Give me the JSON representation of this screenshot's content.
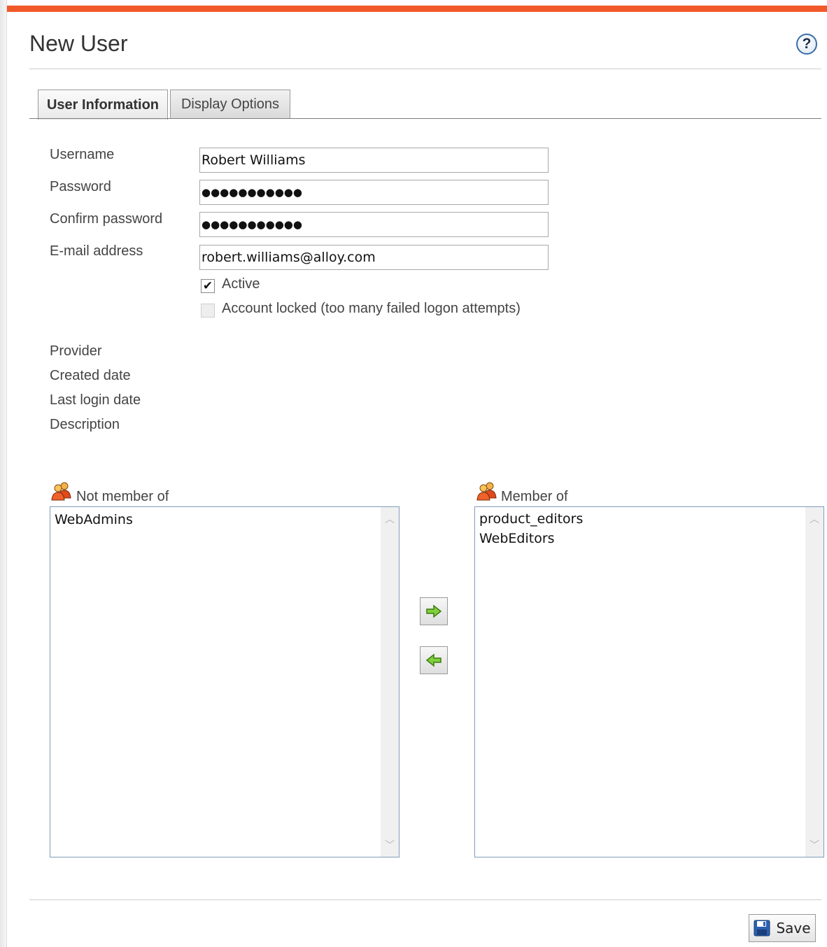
{
  "header": {
    "title": "New User",
    "help_glyph": "?",
    "accent_color": "#f1592a"
  },
  "tabs": [
    {
      "label": "User Information",
      "active": true
    },
    {
      "label": "Display Options",
      "active": false
    }
  ],
  "form": {
    "username": {
      "label": "Username",
      "value": "Robert Williams"
    },
    "password": {
      "label": "Password",
      "value": "●●●●●●●●●●●"
    },
    "confirm_password": {
      "label": "Confirm password",
      "value": "●●●●●●●●●●●"
    },
    "email": {
      "label": "E-mail address",
      "value": "robert.williams@alloy.com"
    },
    "active": {
      "label": "Active",
      "checked": true,
      "glyph": "✔"
    },
    "locked": {
      "label": "Account locked (too many failed logon attempts)",
      "checked": false,
      "disabled": true
    }
  },
  "info": {
    "provider_label": "Provider",
    "created_label": "Created date",
    "last_login_label": "Last login date",
    "description_label": "Description"
  },
  "groups": {
    "not_member_label": "Not member of",
    "not_member_items": [
      "WebAdmins"
    ],
    "member_label": "Member of",
    "member_items": [
      "product_editors",
      "WebEditors"
    ],
    "icon": "user-group-icon"
  },
  "footer": {
    "save_label": "Save",
    "save_icon": "floppy-disk-icon"
  }
}
